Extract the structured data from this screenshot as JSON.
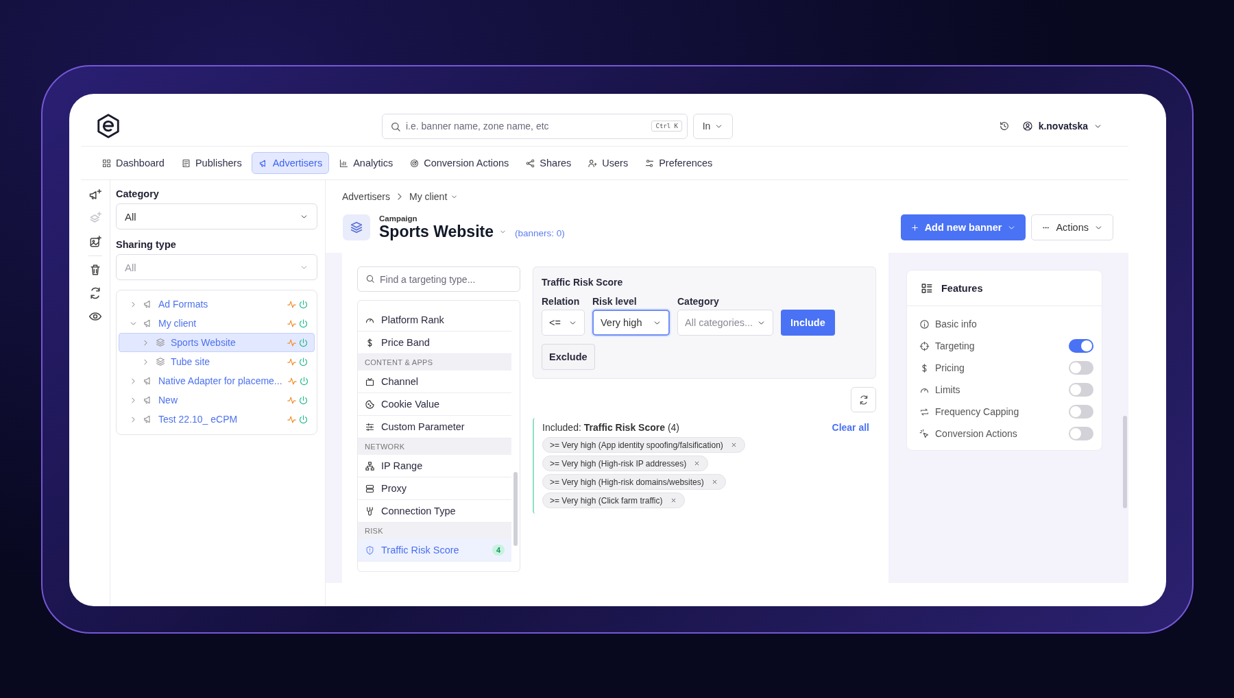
{
  "header": {
    "search": {
      "placeholder": "i.e. banner name, zone name, etc",
      "shortcut": "Ctrl K"
    },
    "scope": "In",
    "user": "k.novatska"
  },
  "nav": [
    {
      "label": "Dashboard",
      "selected": false
    },
    {
      "label": "Publishers",
      "selected": false
    },
    {
      "label": "Advertisers",
      "selected": true
    },
    {
      "label": "Analytics",
      "selected": false
    },
    {
      "label": "Conversion Actions",
      "selected": false
    },
    {
      "label": "Shares",
      "selected": false
    },
    {
      "label": "Users",
      "selected": false
    },
    {
      "label": "Preferences",
      "selected": false
    }
  ],
  "toolbar": [
    {
      "disabled": false
    },
    {
      "disabled": true
    },
    {
      "disabled": false
    },
    {
      "disabled": false
    },
    {
      "disabled": false
    },
    {
      "disabled": false
    }
  ],
  "filters": [
    {
      "label": "Category",
      "value": "All",
      "disabled": false
    },
    {
      "label": "Sharing type",
      "value": "All",
      "disabled": true
    }
  ],
  "tree": [
    {
      "label": "Ad Formats",
      "kind": "advertiser",
      "expanded": false,
      "selected": false
    },
    {
      "label": "My client",
      "kind": "advertiser",
      "expanded": true,
      "selected": false,
      "children": [
        {
          "label": "Sports Website",
          "kind": "campaign",
          "expanded": false,
          "selected": true
        },
        {
          "label": "Tube site",
          "kind": "campaign",
          "expanded": false,
          "selected": false
        }
      ]
    },
    {
      "label": "Native Adapter for placeme...",
      "kind": "advertiser",
      "expanded": false,
      "selected": false
    },
    {
      "label": "New",
      "kind": "advertiser",
      "expanded": false,
      "selected": false
    },
    {
      "label": "Test 22.10_ eCPM",
      "kind": "advertiser",
      "expanded": false,
      "selected": false
    }
  ],
  "breadcrumb": [
    "Advertisers",
    "My client"
  ],
  "campaign": {
    "label": "Campaign",
    "title": "Sports Website",
    "banners": "(banners: 0)"
  },
  "actions": {
    "primary": "Add new banner",
    "secondary": "Actions"
  },
  "targeting": {
    "search_placeholder": "Find a targeting type...",
    "list": [
      {
        "kind": "item",
        "label": "Platform Rank",
        "selected": false
      },
      {
        "kind": "item",
        "label": "Price Band",
        "selected": false
      },
      {
        "kind": "group",
        "label": "CONTENT & APPS"
      },
      {
        "kind": "item",
        "label": "Channel",
        "selected": false
      },
      {
        "kind": "item",
        "label": "Cookie Value",
        "selected": false
      },
      {
        "kind": "item",
        "label": "Custom Parameter",
        "selected": false
      },
      {
        "kind": "group",
        "label": "NETWORK"
      },
      {
        "kind": "item",
        "label": "IP Range",
        "selected": false
      },
      {
        "kind": "item",
        "label": "Proxy",
        "selected": false
      },
      {
        "kind": "item",
        "label": "Connection Type",
        "selected": false
      },
      {
        "kind": "group",
        "label": "RISK"
      },
      {
        "kind": "item",
        "label": "Traffic Risk Score",
        "selected": true,
        "count": "4"
      }
    ],
    "editor": {
      "title": "Traffic Risk Score",
      "fields": [
        {
          "label": "Relation",
          "value": "<=",
          "focused": false
        },
        {
          "label": "Risk level",
          "value": "Very high",
          "focused": true
        },
        {
          "label": "Category",
          "placeholder": "All categories...",
          "focused": false
        }
      ],
      "include": "Include",
      "exclude": "Exclude"
    },
    "summary": {
      "text": "Included: **Traffic Risk Score** (4)",
      "clear": "Clear all",
      "chips": [
        ">= Very high (App identity spoofing/falsification)",
        ">= Very high (High-risk IP addresses)",
        ">= Very high (High-risk domains/websites)",
        ">= Very high (Click farm traffic)"
      ]
    }
  },
  "features": {
    "title": "Features",
    "items": [
      {
        "label": "Basic info",
        "kind": "plain"
      },
      {
        "label": "Targeting",
        "kind": "toggle",
        "on": true
      },
      {
        "label": "Pricing",
        "kind": "toggle",
        "on": false
      },
      {
        "label": "Limits",
        "kind": "toggle",
        "on": false
      },
      {
        "label": "Frequency Capping",
        "kind": "toggle",
        "on": false
      },
      {
        "label": "Conversion Actions",
        "kind": "toggle",
        "on": false
      }
    ]
  }
}
